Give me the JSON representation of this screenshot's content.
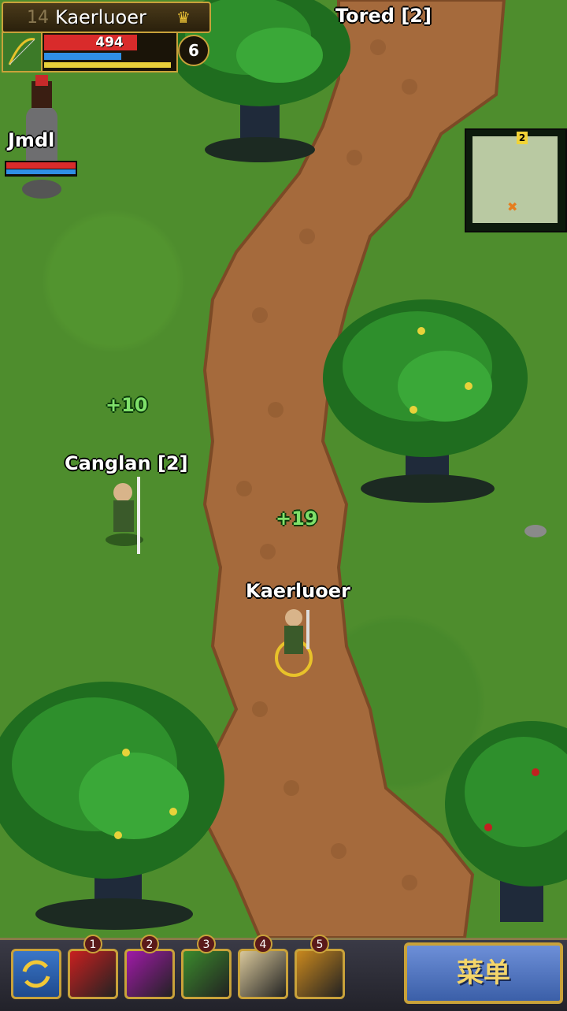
{
  "hud": {
    "level_ghost": "14",
    "player_name": "Kaerluoer",
    "hp_value": "494",
    "hp_fraction": 0.72,
    "mp_fraction": 0.6,
    "xp_fraction": 0.98,
    "level": "6",
    "crown_icon": "crown-icon"
  },
  "world": {
    "npc_top": "Tored [2]",
    "npc_left": "Jmdl",
    "npc_mid": "Canglan [2]",
    "player": "Kaerluoer",
    "float_1": "+10",
    "float_2": "+19"
  },
  "minimap": {
    "zone_number": "2",
    "marker": "✖"
  },
  "action_bar": {
    "slots": [
      {
        "number": "1",
        "icon": "red-arrow-skill-icon",
        "color": "#c82020"
      },
      {
        "number": "2",
        "icon": "shadow-step-skill-icon",
        "color": "#a01aa8"
      },
      {
        "number": "3",
        "icon": "stone-shield-skill-icon",
        "color": "#3b8a2c"
      },
      {
        "number": "4",
        "icon": "black-arrow-skill-icon",
        "color": "#d8c79a"
      },
      {
        "number": "5",
        "icon": "bear-trap-skill-icon",
        "color": "#c9881e"
      }
    ],
    "menu_label": "菜单"
  },
  "colors": {
    "grass": "#4e8d2d",
    "path": "#a56a3c",
    "hp": "#d92b2b",
    "mp": "#2f8fe6",
    "xp": "#e8cf3a",
    "gold_border": "#c9a23a"
  }
}
